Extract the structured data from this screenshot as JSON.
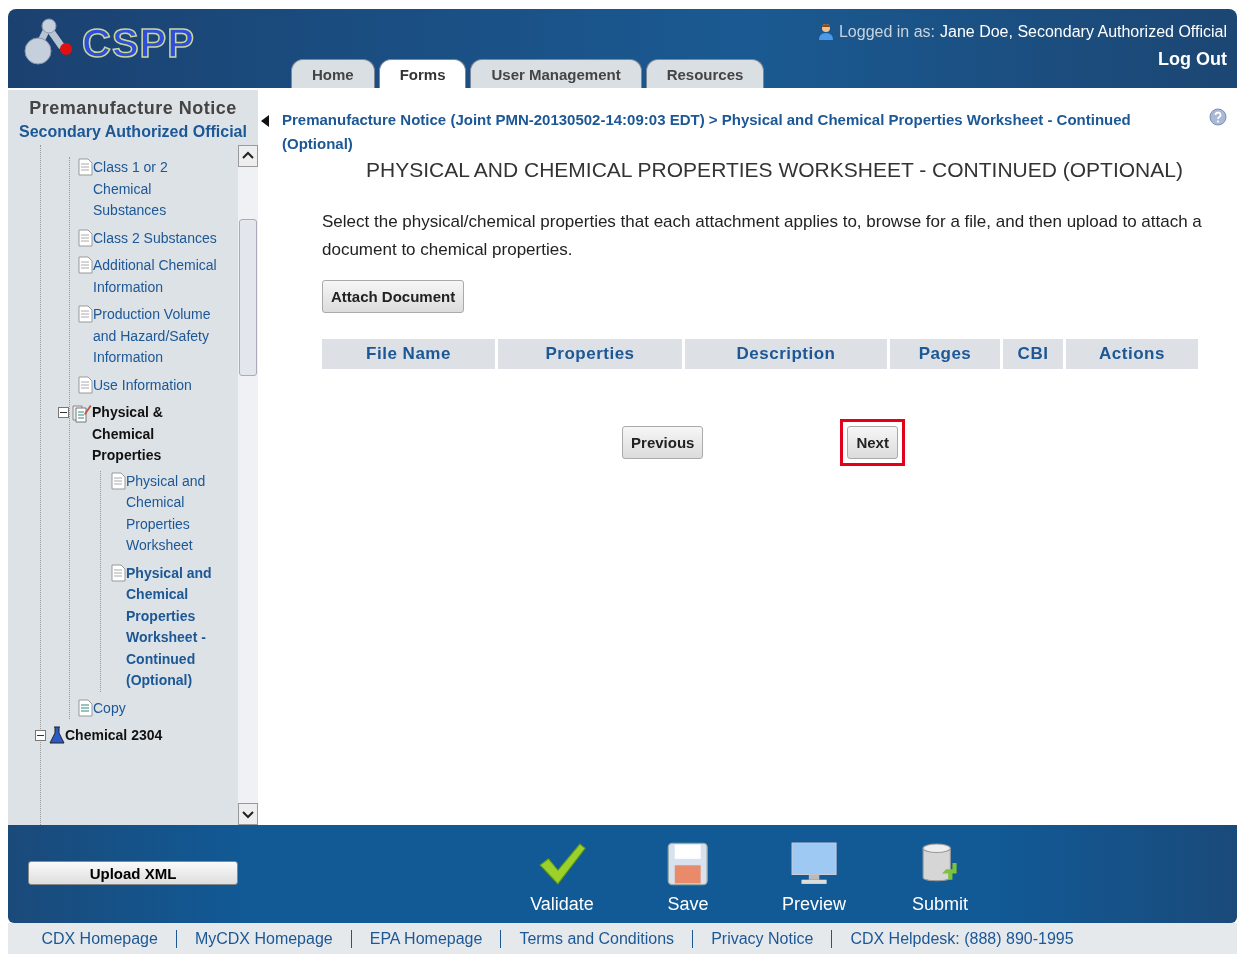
{
  "header": {
    "logo_text": "CSPP",
    "logged_in_label": "Logged in as:",
    "user": "Jane Doe, Secondary Authorized Official",
    "logout": "Log Out"
  },
  "tabs": [
    {
      "label": "Home",
      "selected": false
    },
    {
      "label": "Forms",
      "selected": true
    },
    {
      "label": "User Management",
      "selected": false
    },
    {
      "label": "Resources",
      "selected": false
    }
  ],
  "sidebar": {
    "title": "Premanufacture Notice",
    "role": "Secondary Authorized Official",
    "items": [
      {
        "label": "Class 1 or 2 Chemical Substances",
        "kind": "page",
        "selected": false
      },
      {
        "label": "Class 2 Substances",
        "kind": "page",
        "selected": false
      },
      {
        "label": "Additional Chemical Information",
        "kind": "page",
        "selected": false
      },
      {
        "label": "Production Volume and Hazard/Safety Information",
        "kind": "page",
        "selected": false
      },
      {
        "label": "Use Information",
        "kind": "page",
        "selected": false
      },
      {
        "label": "Physical & Chemical Properties",
        "kind": "folder",
        "selected": false,
        "expanded": true,
        "children": [
          {
            "label": "Physical and Chemical Properties Worksheet",
            "kind": "page",
            "selected": false
          },
          {
            "label": "Physical and Chemical Properties Worksheet - Continued (Optional)",
            "kind": "page",
            "selected": true
          }
        ]
      },
      {
        "label": "Copy",
        "kind": "copy",
        "selected": false
      }
    ],
    "next_items": [
      {
        "label": "Chemical 2304",
        "kind": "chemical",
        "selected": false,
        "expanded": true
      }
    ]
  },
  "breadcrumb": "Premanufacture Notice (Joint PMN-20130502-14:09:03 EDT) > Physical and Chemical Properties Worksheet - Continued (Optional)",
  "page_title": "PHYSICAL AND CHEMICAL PROPERTIES WORKSHEET - CONTINUED (OPTIONAL)",
  "instructions": "Select the physical/chemical properties that each attachment applies to, browse for a file, and then upload to attach a document to chemical properties.",
  "attach_button": "Attach Document",
  "table": {
    "columns": [
      "File Name",
      "Properties",
      "Description",
      "Pages",
      "CBI",
      "Actions"
    ]
  },
  "nav_buttons": [
    {
      "label": "Previous",
      "highlighted": false
    },
    {
      "label": "Next",
      "highlighted": true
    }
  ],
  "bottom_bar": {
    "upload": "Upload XML",
    "actions": [
      {
        "label": "Validate",
        "kind": "validate"
      },
      {
        "label": "Save",
        "kind": "save"
      },
      {
        "label": "Preview",
        "kind": "preview"
      },
      {
        "label": "Submit",
        "kind": "submit"
      }
    ]
  },
  "footer_links": [
    "CDX Homepage",
    "MyCDX Homepage",
    "EPA Homepage",
    "Terms and Conditions",
    "Privacy Notice",
    "CDX Helpdesk: (888) 890-1995"
  ]
}
